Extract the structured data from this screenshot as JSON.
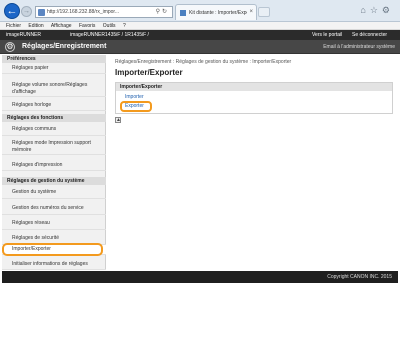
{
  "browser": {
    "url": "http://192.168.232.88/rx_impor...",
    "tab_title": "Kit distante : Importer/Expor...",
    "menu": [
      "Fichier",
      "Edition",
      "Affichage",
      "Favoris",
      "Outils",
      "?"
    ]
  },
  "topbar": {
    "device_name": "imageRUNNER",
    "device_model": "imageRUNNER1435iF / 1R1435iF /",
    "portal_link": "Vers le portail",
    "logout_link": "Se déconnecter"
  },
  "header": {
    "title": "Réglages/Enregistrement",
    "admin_mail": "Email à l'administrateur système"
  },
  "sidebar": {
    "sections": [
      {
        "label": "Préférences"
      },
      {
        "label": "Réglages des fonctions"
      },
      {
        "label": "Réglages de gestion du système"
      }
    ],
    "items": [
      {
        "label": "Réglages papier"
      },
      {
        "label": "Réglage volume sonore/Réglages d'affichage"
      },
      {
        "label": "Réglages horloge"
      },
      {
        "label": "Réglages communs"
      },
      {
        "label": "Réglages mode Impression support mémoire"
      },
      {
        "label": "Réglages d'impression"
      },
      {
        "label": "Gestion du système"
      },
      {
        "label": "Gestion des numéros du service"
      },
      {
        "label": "Réglages réseau"
      },
      {
        "label": "Réglages de sécurité"
      },
      {
        "label": "Importer/Exporter"
      },
      {
        "label": "Initialiser informations de réglages"
      }
    ]
  },
  "main": {
    "breadcrumb": "Réglages/Enregistrement : Réglages de gestion du système : Importer/Exporter",
    "title": "Importer/Exporter",
    "panel_title": "Importer/Exporter",
    "import_link": "Importer",
    "export_link": "Exporter"
  },
  "footer": {
    "copyright": "Copyright CANON INC. 2015"
  },
  "colors": {
    "highlight": "#f39a1e",
    "header_bg": "#474747",
    "link": "#1f5fae"
  }
}
